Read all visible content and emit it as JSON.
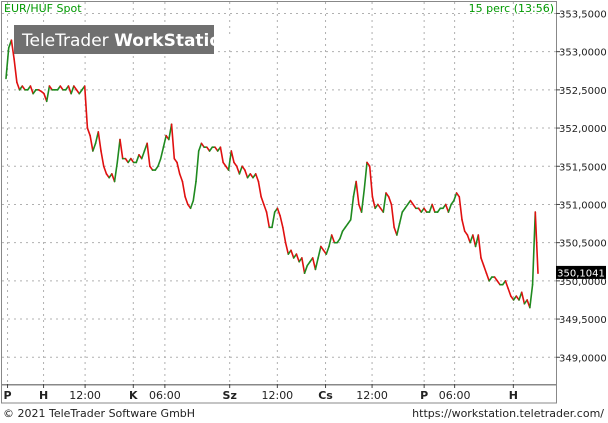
{
  "header": {
    "instrument": "EUR/HUF Spot",
    "delay_info": "15 perc (13:56)",
    "watermark": "TeleTrader ",
    "watermark_bold": "WorkStation"
  },
  "footer": {
    "copyright": "© 2021  TeleTrader Software GmbH",
    "url": "https://workstation.teletrader.com/"
  },
  "colors": {
    "up": "#1f8a1f",
    "down": "#e01010",
    "text": "#009900",
    "grid": "#b0b0b0",
    "last_box": "#000000"
  },
  "chart_data": {
    "type": "line",
    "ylim": [
      348.65,
      353.65
    ],
    "yticks": [
      349.0,
      349.5,
      350.0,
      350.5,
      351.0,
      351.5,
      352.0,
      352.5,
      353.0,
      353.5
    ],
    "ytick_labels": [
      "349,0000",
      "349,5000",
      "350,0000",
      "350,5000",
      "351,0000",
      "351,5000",
      "352,0000",
      "352,5000",
      "353,0000",
      "353,5000"
    ],
    "xtick_labels": [
      {
        "label": "P",
        "pos": 0.01,
        "bold": true
      },
      {
        "label": "H",
        "pos": 0.075,
        "bold": true
      },
      {
        "label": "12:00",
        "pos": 0.15,
        "bold": false
      },
      {
        "label": "K",
        "pos": 0.237,
        "bold": true
      },
      {
        "label": "06:00",
        "pos": 0.294,
        "bold": false
      },
      {
        "label": "Sz",
        "pos": 0.411,
        "bold": true
      },
      {
        "label": "12:00",
        "pos": 0.497,
        "bold": false
      },
      {
        "label": "Cs",
        "pos": 0.584,
        "bold": true
      },
      {
        "label": "12:00",
        "pos": 0.668,
        "bold": false
      },
      {
        "label": "P",
        "pos": 0.762,
        "bold": true
      },
      {
        "label": "06:00",
        "pos": 0.817,
        "bold": false
      },
      {
        "label": "H",
        "pos": 0.923,
        "bold": true
      }
    ],
    "last_value": 350.1041,
    "last_label": "350,1041",
    "series": [
      {
        "values": [
          352.65,
          353.05,
          353.15,
          352.9,
          352.6,
          352.5,
          352.55,
          352.5,
          352.5,
          352.55,
          352.45,
          352.5,
          352.5,
          352.48,
          352.45,
          352.35,
          352.55,
          352.5,
          352.5,
          352.5,
          352.55,
          352.5,
          352.5,
          352.55,
          352.45,
          352.55,
          352.5,
          352.45,
          352.5,
          352.55,
          352.0,
          351.9,
          351.7,
          351.8,
          351.95,
          351.7,
          351.5,
          351.4,
          351.35,
          351.4,
          351.3,
          351.55,
          351.85,
          351.6,
          351.6,
          351.55,
          351.6,
          351.55,
          351.55,
          351.65,
          351.6,
          351.7,
          351.8,
          351.5,
          351.45,
          351.45,
          351.5,
          351.6,
          351.75,
          351.9,
          351.85,
          352.05,
          351.6,
          351.55,
          351.4,
          351.3,
          351.1,
          351.0,
          350.95,
          351.05,
          351.3,
          351.7,
          351.8,
          351.75,
          351.75,
          351.7,
          351.75,
          351.75,
          351.7,
          351.75,
          351.55,
          351.5,
          351.45,
          351.7,
          351.55,
          351.5,
          351.4,
          351.5,
          351.45,
          351.35,
          351.4,
          351.35,
          351.4,
          351.3,
          351.1,
          351.0,
          350.9,
          350.7,
          350.7,
          350.9,
          350.95,
          350.85,
          350.7,
          350.5,
          350.35,
          350.4,
          350.3,
          350.35,
          350.25,
          350.3,
          350.1,
          350.2,
          350.25,
          350.3,
          350.15,
          350.3,
          350.45,
          350.4,
          350.35,
          350.45,
          350.6,
          350.5,
          350.5,
          350.55,
          350.65,
          350.7,
          350.75,
          350.8,
          351.1,
          351.3,
          351.0,
          350.9,
          351.2,
          351.55,
          351.5,
          351.1,
          350.95,
          351.0,
          350.95,
          350.9,
          351.15,
          351.1,
          351.0,
          350.7,
          350.6,
          350.75,
          350.9,
          350.95,
          351.0,
          351.05,
          351.0,
          350.95,
          350.95,
          350.9,
          350.95,
          350.9,
          350.9,
          351.0,
          350.9,
          350.9,
          350.95,
          350.95,
          351.0,
          350.9,
          351.0,
          351.05,
          351.15,
          351.1,
          350.8,
          350.65,
          350.6,
          350.5,
          350.6,
          350.45,
          350.6,
          350.3,
          350.2,
          350.1,
          350.0,
          350.05,
          350.05,
          350.0,
          349.95,
          349.95,
          350.0,
          349.9,
          349.8,
          349.75,
          349.8,
          349.75,
          349.85,
          349.7,
          349.75,
          349.65,
          349.95,
          350.9,
          350.1
        ]
      }
    ]
  }
}
